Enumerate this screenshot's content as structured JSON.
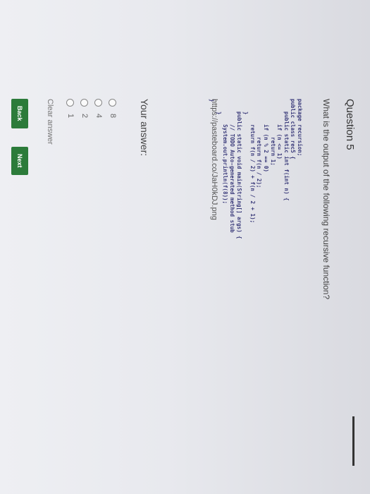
{
  "question": {
    "title": "Question 5",
    "prompt": "What is the output of the following recursive function?",
    "link": "https://pasteboard.co/JaH0kDJ.png"
  },
  "code": {
    "line1": "package recursion;",
    "line2": "public class rec5 {",
    "line3": "    public static int f(int n) {",
    "line4": "        if (n <= 1)",
    "line5": "            return 1;",
    "line6": "        if (n % 2 == 0)",
    "line7": "            return f(n / 2);",
    "line8": "        return f(n / 2) + f(n / 2 + 1);",
    "line9": "    }",
    "line10": "    public static void main(String[] args) {",
    "line11": "        // TODO Auto-generated method stub",
    "line12": "        System.out.println(f(8));",
    "line13": "    }",
    "line14": "}"
  },
  "answer": {
    "heading": "Your answer:",
    "options": [
      "8",
      "4",
      "2",
      "1"
    ],
    "clear_label": "Clear answer"
  },
  "nav": {
    "back_label": "Back",
    "next_label": "Next"
  }
}
